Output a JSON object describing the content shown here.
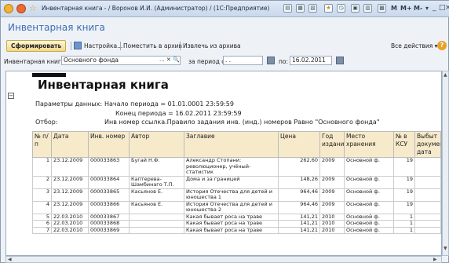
{
  "window": {
    "title": "Инвентарная книга - / Воронов И.И. (Администратор) / (1С:Предприятие)",
    "toolbar_letters": [
      "M",
      "M+",
      "M-"
    ]
  },
  "form": {
    "heading": "Инвентарная книга"
  },
  "toolbar": {
    "generate_label": "Сформировать",
    "settings_label": "Настройка...",
    "archive_put_label": "Поместить в архив",
    "archive_extract_label": "Извлечь из архива",
    "all_actions_label": "Все действия ▾",
    "help_label": "?"
  },
  "params": {
    "book_label": "Инвентарная книга:",
    "book_value": "Основного фонда",
    "book_buttons": "... ✕ 🔍",
    "period_from_label": "за период с:",
    "period_from_value": " .  .",
    "period_to_label": "по:",
    "period_to_value": "16.02.2011"
  },
  "report": {
    "title": "Инвентарная книга",
    "params_label": "Параметры данных:",
    "period_start": "Начало периода = 01.01.0001 23:59:59",
    "period_end": "Конец периода = 16.02.2011 23:59:59",
    "filter_label": "Отбор:",
    "filter_value": "Инв номер ссылка.Правило задания инв. (инд.) номеров Равно \"Основного фонда\"",
    "columns": [
      "№ п/п",
      "Дата",
      "Инв. номер",
      "Автор",
      "Заглавие",
      "Цена",
      "Год издания",
      "Место хранения",
      "№ в КСУ",
      "Выбыт документ, дата"
    ],
    "rows": [
      [
        "1",
        "23.12.2009",
        "000033863",
        "Бугай Н.Ф.",
        "Александр Стопани: революционер, учёный-статистик",
        "262,60",
        "2009",
        "Основной ф.",
        "19",
        ""
      ],
      [
        "2",
        "23.12.2009",
        "000033864",
        "Каптерева-Шамбинаго Т.П.",
        "Дома и за границей",
        "148,26",
        "2009",
        "Основной ф.",
        "19",
        ""
      ],
      [
        "3",
        "23.12.2009",
        "000033865",
        "Касьянов Е.",
        "История Отечества для детей и юношества 1",
        "964,46",
        "2009",
        "Основной ф.",
        "19",
        ""
      ],
      [
        "4",
        "23.12.2009",
        "000033866",
        "Касьянов Е.",
        "История Отечества для детей и юношества 2",
        "964,46",
        "2009",
        "Основной ф.",
        "19",
        ""
      ],
      [
        "5",
        "22.03.2010",
        "000033867",
        "",
        "Какая бывает роса на траве",
        "141,21",
        "2010",
        "Основной ф.",
        "1",
        ""
      ],
      [
        "6",
        "22.03.2010",
        "000033868",
        "",
        "Какая бывает роса на траве",
        "141,21",
        "2010",
        "Основной ф.",
        "1",
        ""
      ],
      [
        "7",
        "22.03.2010",
        "000033869",
        "",
        "Какая бывает роса на траве",
        "141,21",
        "2010",
        "Основной ф.",
        "1",
        ""
      ]
    ]
  }
}
